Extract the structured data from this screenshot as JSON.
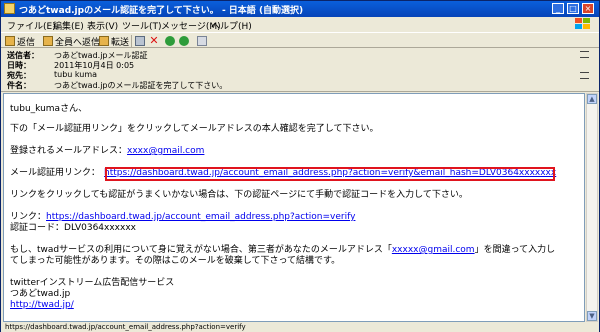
{
  "window": {
    "title": "つあどtwad.jpのメール認証を完了して下さい。 - 日本語 (自動選択)"
  },
  "menu": [
    "ファイル(E)",
    "編集(E)",
    "表示(V)",
    "ツール(T)",
    "メッセージ(M)",
    "ヘルプ(H)"
  ],
  "toolbar": {
    "reply": "返信",
    "reply_all": "全員へ返信",
    "forward": "転送"
  },
  "header": {
    "from_label": "送信者：",
    "from_value": "つあどtwad.jpメール認証",
    "date_label": "日時：",
    "date_value": "2011年10月4日 0:05",
    "to_label": "宛先：",
    "to_value": "tubu kuma",
    "subject_label": "件名：",
    "subject_value": "つあどtwad.jpのメール認証を完了して下さい。"
  },
  "body": {
    "greeting": "tubu_kumaさん、",
    "intro": "下の「メール認証用リンク」をクリックしてメールアドレスの本人確認を完了して下さい。",
    "registered_label": "登録されるメールアドレス：",
    "registered_email": "xxxx@gmail.com",
    "auth_label": "メール認証用リンク：",
    "auth_link": "https://dashboard.twad.jp/account_email_address.php?action=verify&email_hash=DLV0364xxxxxxx",
    "fail_note": "リンクをクリックしても認証がうまくいかない場合は、下の認証ページにて手動で認証コードを入力して下さい。",
    "link_label": "リンク：",
    "manual_link": "https://dashboard.twad.jp/account_email_address.php?action=verify",
    "code_label": "認証コード：",
    "code_value": "DLV0364xxxxxx",
    "warning_1": "もし、twadサービスの利用について身に覚えがない場合、第三者があなたのメールアドレス「",
    "warning_email": "xxxxx@gmail.com",
    "warning_2": "」を間違って入力し",
    "warning_3": "てしまった可能性があります。その際はこのメールを破棄して下さって結構です。",
    "signature_1": "twitterインストリーム広告配信サービス",
    "signature_2": "つあどtwad.jp",
    "signature_link": "http://twad.jp/"
  },
  "status": {
    "text": "https://dashboard.twad.jp/account_email_address.php?action=verify"
  },
  "colors": {
    "highlight_border": "#e0141e",
    "link": "#0000ee",
    "titlebar": "#0a5fdc"
  }
}
